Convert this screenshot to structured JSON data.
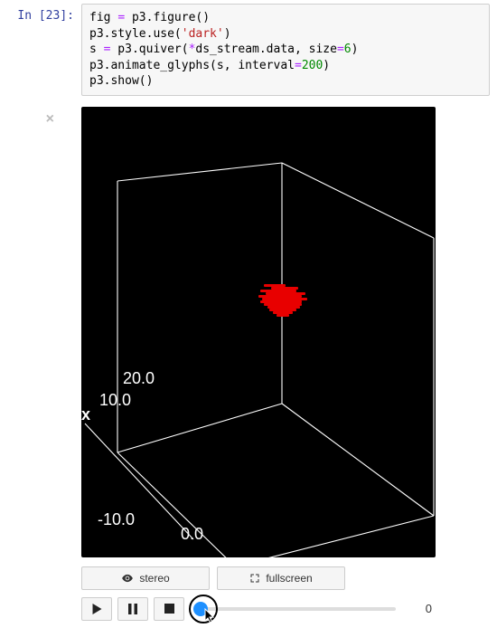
{
  "cell_prompt": "In [23]:",
  "code": {
    "l1a": "fig ",
    "l1b": "=",
    "l1c": " p3.figure()",
    "l2a": "p3.style.use(",
    "l2b": "'dark'",
    "l2c": ")",
    "l3a": "s ",
    "l3b": "=",
    "l3c": " p3.quiver(",
    "l3d": "*",
    "l3e": "ds_stream.data, size",
    "l3f": "=",
    "l3g": "6",
    "l3h": ")",
    "l4a": "p3.animate_glyphs(s, interval",
    "l4b": "=",
    "l4c": "200",
    "l4d": ")",
    "l5": "p3.show()"
  },
  "close_label": "×",
  "axes": {
    "xlabel": "x",
    "ticks": {
      "t1": "20.0",
      "t2": "10.0",
      "t3": "-10.0",
      "t4": "0.0"
    }
  },
  "controls": {
    "stereo": "stereo",
    "fullscreen": "fullscreen"
  },
  "player": {
    "frame": "0"
  }
}
